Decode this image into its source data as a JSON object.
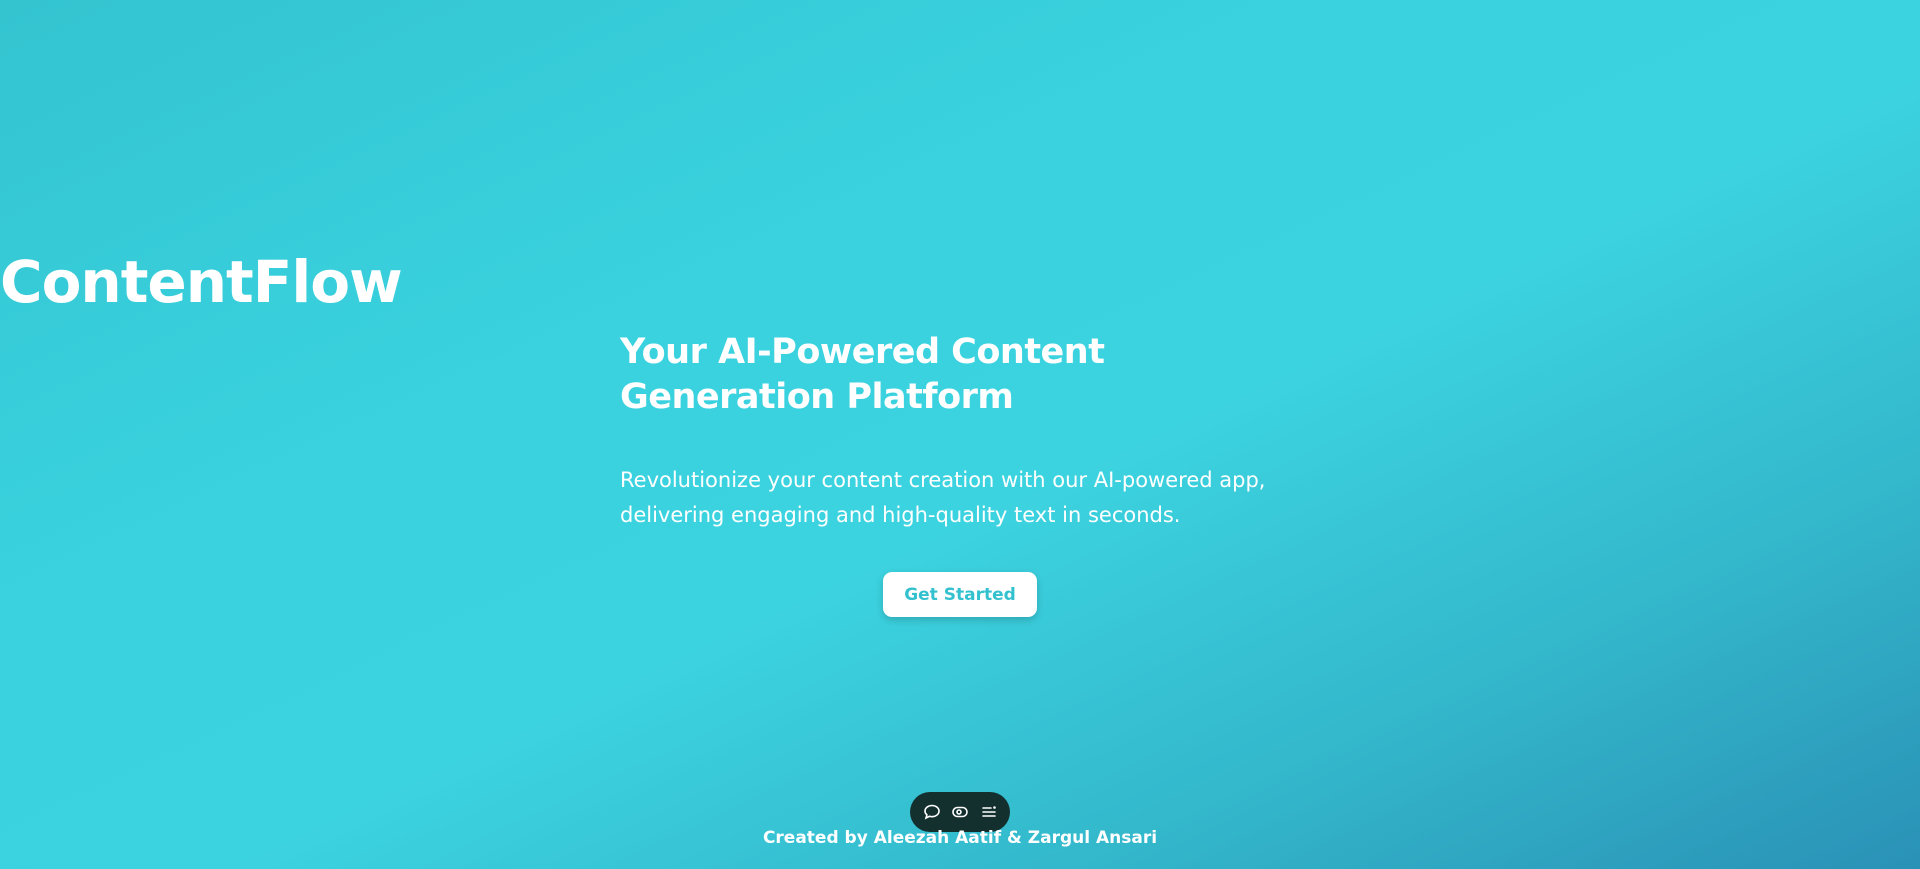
{
  "hero": {
    "title": "ContentFlow",
    "subtitle": "Your AI-Powered Content Generation Platform",
    "description": "Revolutionize your content creation with our AI-powered app, delivering engaging and high-quality text in seconds.",
    "cta_label": "Get Started"
  },
  "toolbar": {
    "icons": [
      "chat-bubble-icon",
      "eye-icon",
      "menu-list-icon"
    ]
  },
  "footer": {
    "credit": "Created by Aleezah Aatif & Zargul Ansari"
  },
  "colors": {
    "accent": "#33c1cf",
    "background_start": "#33c4d0",
    "background_end": "#2a91b6",
    "toolbar_bg": "#13302f"
  }
}
